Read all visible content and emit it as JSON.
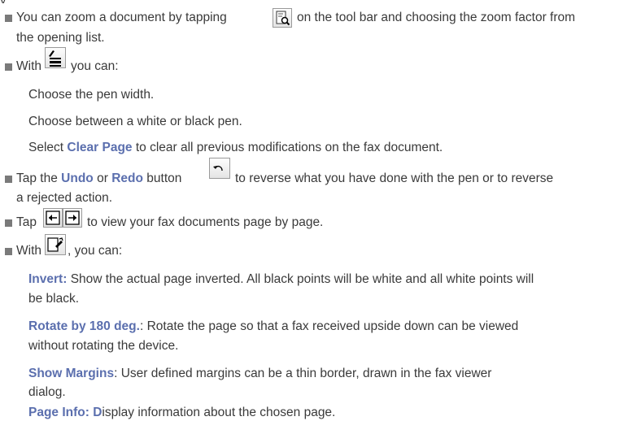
{
  "top_fragment": "y",
  "items": {
    "zoom": {
      "line1_before": "You can zoom a document by tapping",
      "line1_after": "on the tool bar and choosing the zoom factor from",
      "line2": "the opening list."
    },
    "pen": {
      "before": "With",
      "after": "you can:",
      "sub1": "Choose the pen width.",
      "sub2": "Choose between a white or black pen.",
      "sub3_before": "Select",
      "sub3_em": "Clear Page",
      "sub3_after": "to clear all previous modifications on the fax document."
    },
    "undo": {
      "before": "Tap the",
      "undo": "Undo",
      "or": "or",
      "redo": "Redo",
      "button": "button",
      "after": "to reverse what you have done with the pen or to reverse",
      "line2": "a rejected action."
    },
    "pages": {
      "before": "Tap",
      "after": "to view your fax documents page by page."
    },
    "tools": {
      "before": "With",
      "after": ", you can:",
      "invert_em": "Invert:",
      "invert_text1": "Show the actual page inverted. All black points will be white and all white points will",
      "invert_text2": "be black.",
      "rotate_em": "Rotate by 180 deg.",
      "rotate_text1": ": Rotate the page so that a fax received upside down can be viewed",
      "rotate_text2": "without rotating the device.",
      "margins_em": "Show Margins",
      "margins_text1": ": User defined margins can be a thin border, drawn in the fax viewer",
      "margins_text2": "dialog.",
      "pageinfo_em": "Page Info: D",
      "pageinfo_text": "isplay information about the chosen page."
    }
  },
  "icons": {
    "zoom": "zoom-page-icon",
    "pen": "pen-settings-icon",
    "undo": "undo-icon",
    "prev": "previous-page-icon",
    "next": "next-page-icon",
    "tools": "view-tools-icon"
  },
  "colors": {
    "text": "#3a3a3a",
    "emphasis": "#5b6fae",
    "bullet": "#7a7a7a"
  }
}
